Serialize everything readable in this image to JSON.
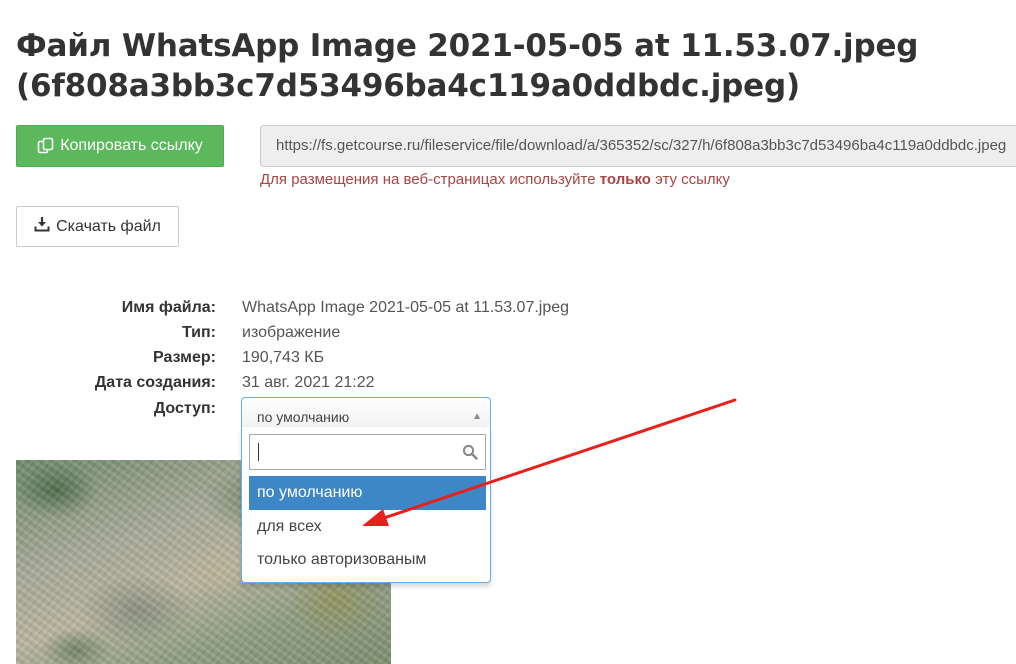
{
  "page": {
    "title_line1": "Файл WhatsApp Image 2021-05-05 at 11.53.07.jpeg",
    "title_line2": "(6f808a3bb3c7d53496ba4c119a0ddbdc.jpeg)"
  },
  "actions": {
    "copy_link_label": "Копировать ссылку",
    "download_label": "Скачать файл",
    "copy_icon": "copy-icon",
    "download_icon": "download-icon"
  },
  "link": {
    "url": "https://fs.getcourse.ru/fileservice/file/download/a/365352/sc/327/h/6f808a3bb3c7d53496ba4c119a0ddbdc.jpeg",
    "hint_before": "Для размещения на веб-страницах используйте ",
    "hint_bold": "только",
    "hint_after": " эту ссылку"
  },
  "info": {
    "filename_label": "Имя файла:",
    "filename_value": "WhatsApp Image 2021-05-05 at 11.53.07.jpeg",
    "type_label": "Тип:",
    "type_value": "изображение",
    "size_label": "Размер:",
    "size_value": "190,743 КБ",
    "created_label": "Дата создания:",
    "created_value": "31 авг. 2021 21:22",
    "access_label": "Доступ:"
  },
  "access_select": {
    "selected": "по умолчанию",
    "search_value": "",
    "options": [
      "по умолчанию",
      "для всех",
      "только авторизованым"
    ],
    "highlighted_index": 0
  },
  "colors": {
    "primary_green": "#5cb85c",
    "hint_red": "#a94442",
    "highlight_blue": "#3d87c6",
    "annotation_arrow": "#e8201c"
  }
}
